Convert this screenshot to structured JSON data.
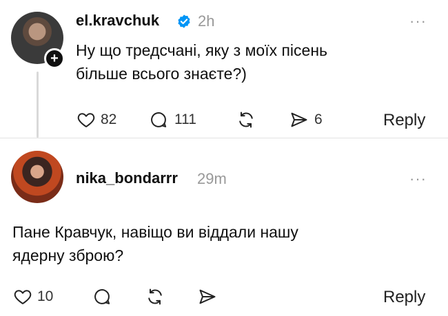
{
  "posts": [
    {
      "username": "el.kravchuk",
      "time": "2h",
      "verified": true,
      "text_lines": [
        "Ну що тредсчані, яку з моїх пісень",
        "більше всього знаєте?)"
      ],
      "likes": "82",
      "comments": "111",
      "shares": "6",
      "reply_label": "Reply",
      "more": "···"
    },
    {
      "username": "nika_bondarrr",
      "time": "29m",
      "text_lines": [
        "Пане Кравчук, навіщо ви віддали нашу",
        "ядерну зброю?"
      ],
      "likes": "10",
      "reply_label": "Reply",
      "more": "···"
    }
  ],
  "colors": {
    "verified": "#0095f6",
    "muted": "#999999",
    "text": "#101010"
  },
  "icons": [
    "heart-icon",
    "comment-icon",
    "repost-icon",
    "share-icon",
    "verified-icon",
    "plus-icon",
    "more-icon"
  ]
}
